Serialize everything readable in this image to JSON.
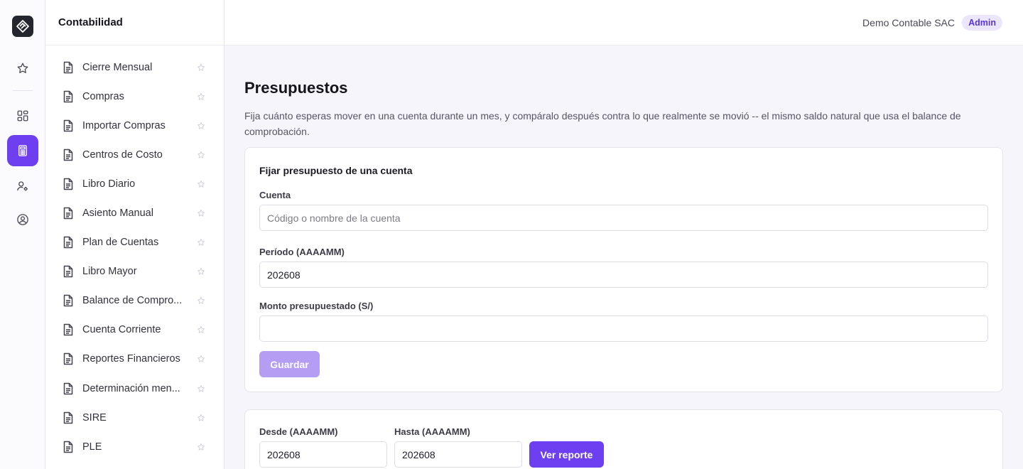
{
  "rail": {
    "items": [
      {
        "icon": "star-icon"
      },
      {
        "icon": "dashboard-icon"
      },
      {
        "icon": "calculator-icon",
        "active": true
      },
      {
        "icon": "user-settings-icon"
      },
      {
        "icon": "user-circle-icon"
      }
    ]
  },
  "sidebar": {
    "title": "Contabilidad",
    "items": [
      {
        "label": "Cierre Mensual"
      },
      {
        "label": "Compras"
      },
      {
        "label": "Importar Compras"
      },
      {
        "label": "Centros de Costo"
      },
      {
        "label": "Libro Diario"
      },
      {
        "label": "Asiento Manual"
      },
      {
        "label": "Plan de Cuentas"
      },
      {
        "label": "Libro Mayor"
      },
      {
        "label": "Balance de Compro..."
      },
      {
        "label": "Cuenta Corriente"
      },
      {
        "label": "Reportes Financieros"
      },
      {
        "label": "Determinación men..."
      },
      {
        "label": "SIRE"
      },
      {
        "label": "PLE"
      }
    ]
  },
  "header": {
    "company": "Demo Contable SAC",
    "role": "Admin"
  },
  "page": {
    "title": "Presupuestos",
    "description": "Fija cuánto esperas mover en una cuenta durante un mes, y compáralo después contra lo que realmente se movió -- el mismo saldo natural que usa el balance de comprobación."
  },
  "budget_form": {
    "title": "Fijar presupuesto de una cuenta",
    "account_label": "Cuenta",
    "account_placeholder": "Código o nombre de la cuenta",
    "account_value": "",
    "period_label": "Período (AAAAMM)",
    "period_value": "202608",
    "amount_label": "Monto presupuestado (S/)",
    "amount_value": "",
    "save_label": "Guardar"
  },
  "report_filter": {
    "from_label": "Desde (AAAAMM)",
    "from_value": "202608",
    "to_label": "Hasta (AAAAMM)",
    "to_value": "202608",
    "submit_label": "Ver reporte"
  },
  "colors": {
    "accent": "#6d3ff0",
    "accent_disabled": "#b39ef4",
    "badge_bg": "#ece6fd"
  }
}
